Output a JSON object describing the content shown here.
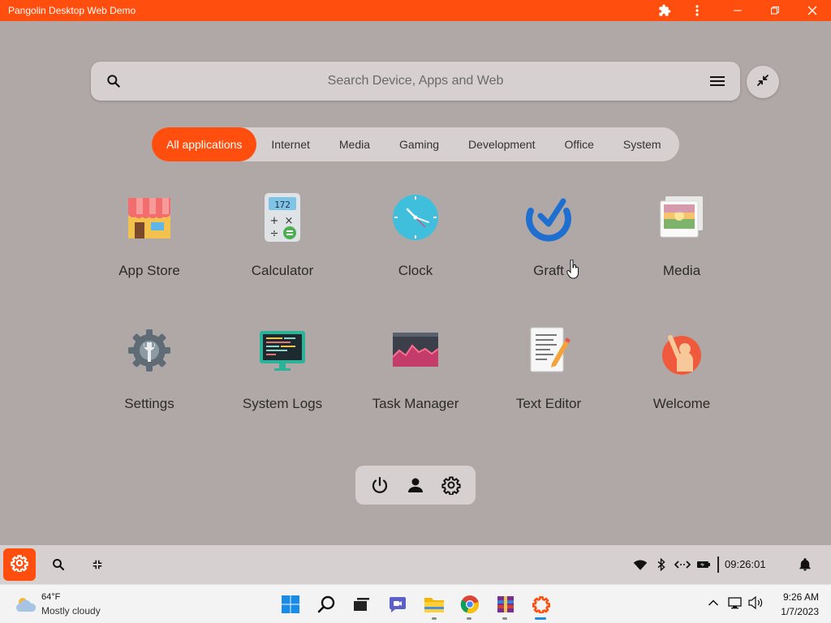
{
  "window": {
    "title": "Pangolin Desktop Web Demo"
  },
  "search": {
    "placeholder": "Search Device, Apps and Web"
  },
  "categories": [
    "All applications",
    "Internet",
    "Media",
    "Gaming",
    "Development",
    "Office",
    "System"
  ],
  "apps": [
    {
      "label": "App Store",
      "icon": "app-store-icon"
    },
    {
      "label": "Calculator",
      "icon": "calculator-icon"
    },
    {
      "label": "Clock",
      "icon": "clock-icon"
    },
    {
      "label": "Graft",
      "icon": "graft-icon"
    },
    {
      "label": "Media",
      "icon": "media-icon"
    },
    {
      "label": "Settings",
      "icon": "settings-icon"
    },
    {
      "label": "System Logs",
      "icon": "system-logs-icon"
    },
    {
      "label": "Task Manager",
      "icon": "task-manager-icon"
    },
    {
      "label": "Text Editor",
      "icon": "text-editor-icon"
    },
    {
      "label": "Welcome",
      "icon": "welcome-icon"
    }
  ],
  "shell_taskbar": {
    "time": "09:26:01"
  },
  "windows_taskbar": {
    "weather": {
      "temp": "64°F",
      "desc": "Mostly cloudy"
    },
    "clock": {
      "time": "9:26 AM",
      "date": "1/7/2023"
    }
  },
  "colors": {
    "accent": "#ff4e0d",
    "background": "#b0a8a6",
    "surface": "#d6d1d0"
  }
}
